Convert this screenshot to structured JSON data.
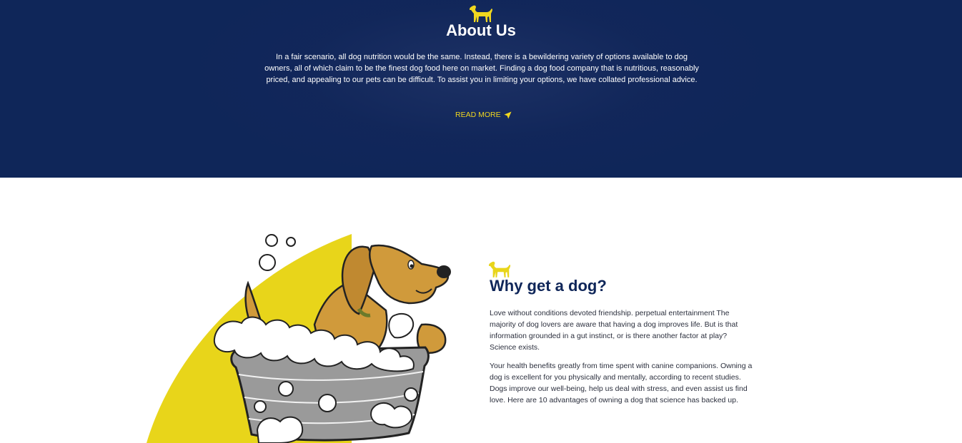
{
  "about": {
    "title": "About Us",
    "text": "In a fair scenario, all dog nutrition would be the same. Instead, there is a bewildering variety of options available to dog owners, all of which claim to be the finest dog food here on market. Finding a dog food company that is nutritious, reasonably priced, and appealing to our pets can be difficult. To assist you in limiting your options, we have collated professional advice.",
    "read_more": "READ MORE",
    "bg_color": "#0f2659",
    "accent": "#f0d71f"
  },
  "why": {
    "title": "Why get a dog?",
    "paragraph1": "Love without conditions devoted friendship. perpetual entertainment The majority of dog lovers are aware that having a dog improves life. But is that information grounded in a gut instinct, or is there another factor at play? Science exists.",
    "paragraph2": "Your health benefits greatly from time spent with canine companions. Owning a dog is excellent for you physically and mentally, according to recent studies. Dogs improve our well-being, help us deal with stress, and even assist us find love. Here are 10 advantages of owning a dog that science has backed up.",
    "title_color": "#0f2659",
    "shape_color": "#e8d51a"
  },
  "icons": {
    "section_icon": "dog-silhouette-icon",
    "read_more_icon": "paper-plane-icon",
    "illustration": "dog-in-bathtub-illustration"
  }
}
